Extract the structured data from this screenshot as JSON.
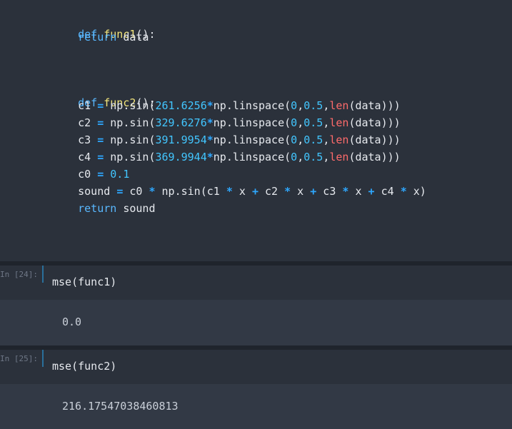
{
  "code_cell": {
    "lines": [
      {
        "t": "def func1():"
      },
      {
        "t": "    return data"
      },
      {
        "t": "def func2():"
      },
      {
        "t": "    c1 = np.sin(261.6256*np.linspace(0,0.5,len(data)))"
      },
      {
        "t": "    c2 = np.sin(329.6276*np.linspace(0,0.5,len(data)))"
      },
      {
        "t": "    c3 = np.sin(391.9954*np.linspace(0,0.5,len(data)))"
      },
      {
        "t": "    c4 = np.sin(369.9944*np.linspace(0,0.5,len(data)))"
      },
      {
        "t": "    c0 = 0.1"
      },
      {
        "t": "    sound = c0 * np.sin(c1 * x + c2 * x + c3 * x + c4 * x)"
      },
      {
        "t": "    return sound"
      }
    ]
  },
  "cells": [
    {
      "prompt": "In [24]:",
      "input": "mse(func1)",
      "output": "0.0"
    },
    {
      "prompt": "In [25]:",
      "input": "mse(func2)",
      "output": "216.17547038460813"
    }
  ],
  "colors": {
    "keyword": "#59b8ff",
    "function_name": "#f3e57a",
    "number": "#42c6ff",
    "operator": "#2ea8ff",
    "builtin": "#ff6b6b"
  }
}
